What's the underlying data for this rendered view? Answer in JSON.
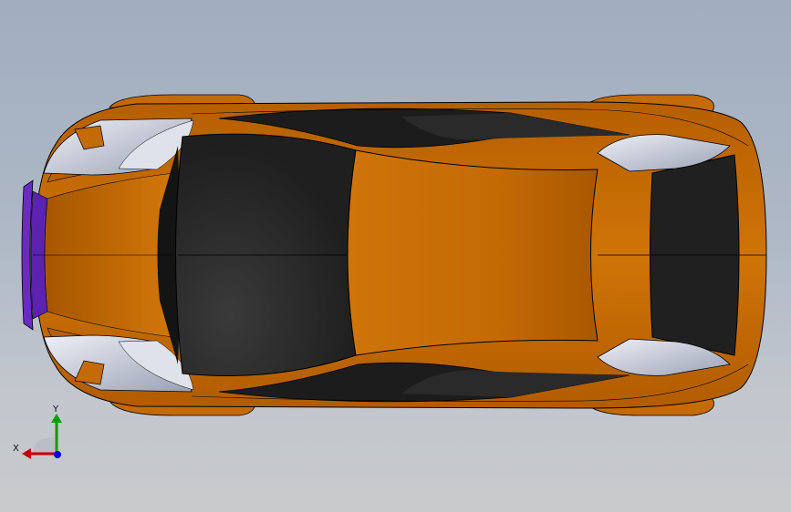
{
  "viewport": {
    "background_top": "#a1aec0",
    "background_bottom": "#c9cacc"
  },
  "model": {
    "body_color": "#c46a06",
    "body_dark": "#8a4500",
    "glass_color": "#1e1e1e",
    "light_color": "#c7ccd8",
    "accent_color": "#6a2bc2"
  },
  "triad": {
    "x_label": "X",
    "y_label": "Y",
    "x_color": "#c00000",
    "y_color": "#00a000",
    "z_color": "#0000d0"
  }
}
